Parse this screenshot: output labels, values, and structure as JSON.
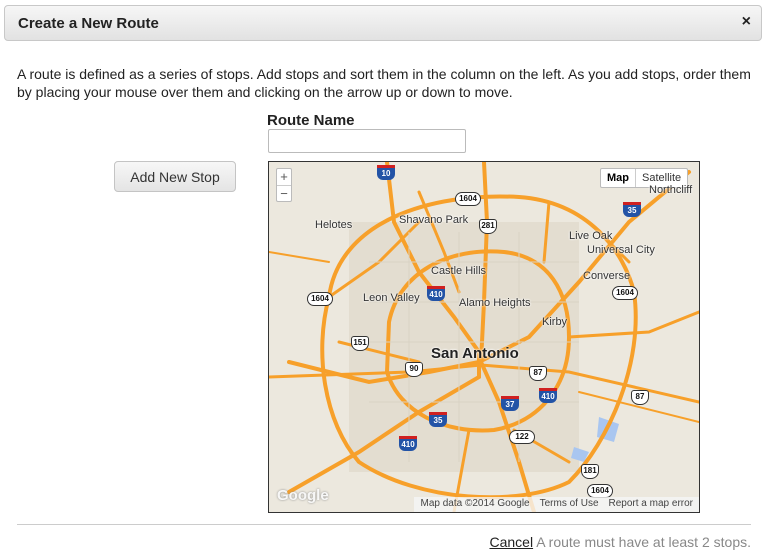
{
  "dialog": {
    "title": "Create a New Route",
    "close_glyph": "×",
    "description": "A route is defined as a series of stops. Add stops and sort them in the column on the left. As you add stops, order them by placing your mouse over them and clicking on the arrow up or down to move."
  },
  "route": {
    "label": "Route Name",
    "value": "",
    "placeholder": ""
  },
  "stops": {
    "add_label": "Add New Stop"
  },
  "map": {
    "zoom_in": "+",
    "zoom_out": "−",
    "type_map": "Map",
    "type_satellite": "Satellite",
    "logo": "Google",
    "attribution": "Map data ©2014 Google",
    "terms": "Terms of Use",
    "report": "Report a map error",
    "places": {
      "northcliff": "Northcliff",
      "shavano_park": "Shavano Park",
      "helotes": "Helotes",
      "live_oak": "Live Oak",
      "universal_city": "Universal City",
      "castle_hills": "Castle Hills",
      "converse": "Converse",
      "leon_valley": "Leon Valley",
      "alamo_heights": "Alamo Heights",
      "kirby": "Kirby",
      "san_antonio": "San Antonio"
    },
    "shields": {
      "i10": "10",
      "l1604_top": "1604",
      "i281": "281",
      "i35_ne": "35",
      "i410_n": "410",
      "l1604_w": "1604",
      "l1604_e": "1604",
      "r151": "151",
      "r90": "90",
      "r87": "87",
      "i410_e": "410",
      "r87_e": "87",
      "i37": "37",
      "i35_s": "35",
      "r122": "122",
      "i410_sw": "410",
      "r181": "181",
      "l1604_se": "1604"
    },
    "colors": {
      "highway": "#f7a02a",
      "water": "#a9c6f0",
      "land": "#ece8de"
    }
  },
  "footer": {
    "cancel_label": "Cancel",
    "message": "A route must have at least 2 stops."
  }
}
